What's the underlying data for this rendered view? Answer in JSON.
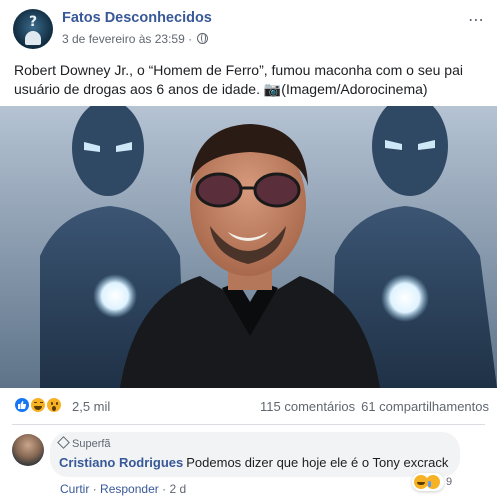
{
  "post": {
    "page_name": "Fatos Desconhecidos",
    "timestamp": "3 de fevereiro às 23:59",
    "separator": "·",
    "more_icon": "⋯",
    "text_line1": "Robert Downey Jr., o “Homem de Ferro”, fumou maconha com o seu pai",
    "text_line2": "usuário de drogas aos 6 anos de idade. 📷(Imagem/Adorocinema)"
  },
  "stats": {
    "reactions_count": "2,5 mil",
    "comments_count": "115 comentários",
    "shares_count": "61 compartilhamentos"
  },
  "comment": {
    "badge": "Superfã",
    "author": "Cristiano Rodrigues",
    "text": "Podemos dizer que hoje ele é o Tony excrack",
    "reactions_count": "9",
    "actions": {
      "like": "Curtir",
      "dot1": "·",
      "reply": "Responder",
      "dot2": "·",
      "time": "2 d"
    }
  },
  "colors": {
    "link_blue": "#385898",
    "like_blue": "#1877f2",
    "emoji_yellow": "#f7b125",
    "meta_gray": "#616770"
  },
  "icons": [
    "page-avatar",
    "globe-icon",
    "more-icon",
    "like-reaction-icon",
    "haha-reaction-icon",
    "wow-reaction-icon",
    "superfan-diamond-icon"
  ]
}
